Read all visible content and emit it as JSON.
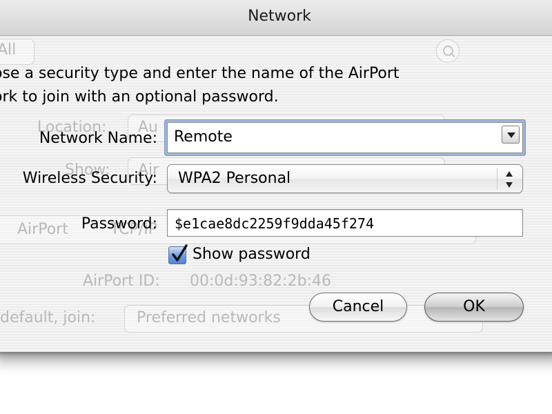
{
  "window": {
    "title": "Network"
  },
  "background": {
    "toolbar_left": "All",
    "location_label": "Location:",
    "location_value": "Au",
    "show_label": "Show:",
    "show_value": "Air",
    "tab_airport": "AirPort",
    "tab_tcpip": "TCP/IP",
    "airport_id_label": "AirPort ID:",
    "airport_id_value": "00:0d:93:82:2b:46",
    "join_label": "default, join:",
    "join_value": "Preferred networks"
  },
  "sheet": {
    "prompt_line1": "ose a security type and enter the name of the AirPort",
    "prompt_line2": "ork to join with an optional password.",
    "network_name_label": "Network Name:",
    "network_name_value": "Remote",
    "security_label": "Wireless Security:",
    "security_value": "WPA2 Personal",
    "password_label": "Password:",
    "password_value": "$e1cae8dc2259f9dda45f274",
    "show_password_label": "Show password",
    "show_password_checked": true,
    "cancel_label": "Cancel",
    "ok_label": "OK"
  },
  "colors": {
    "focus_ring": "#9fb6d9",
    "checkbox_blue": "#4f85d6",
    "window_bg": "#e6e6e6"
  }
}
